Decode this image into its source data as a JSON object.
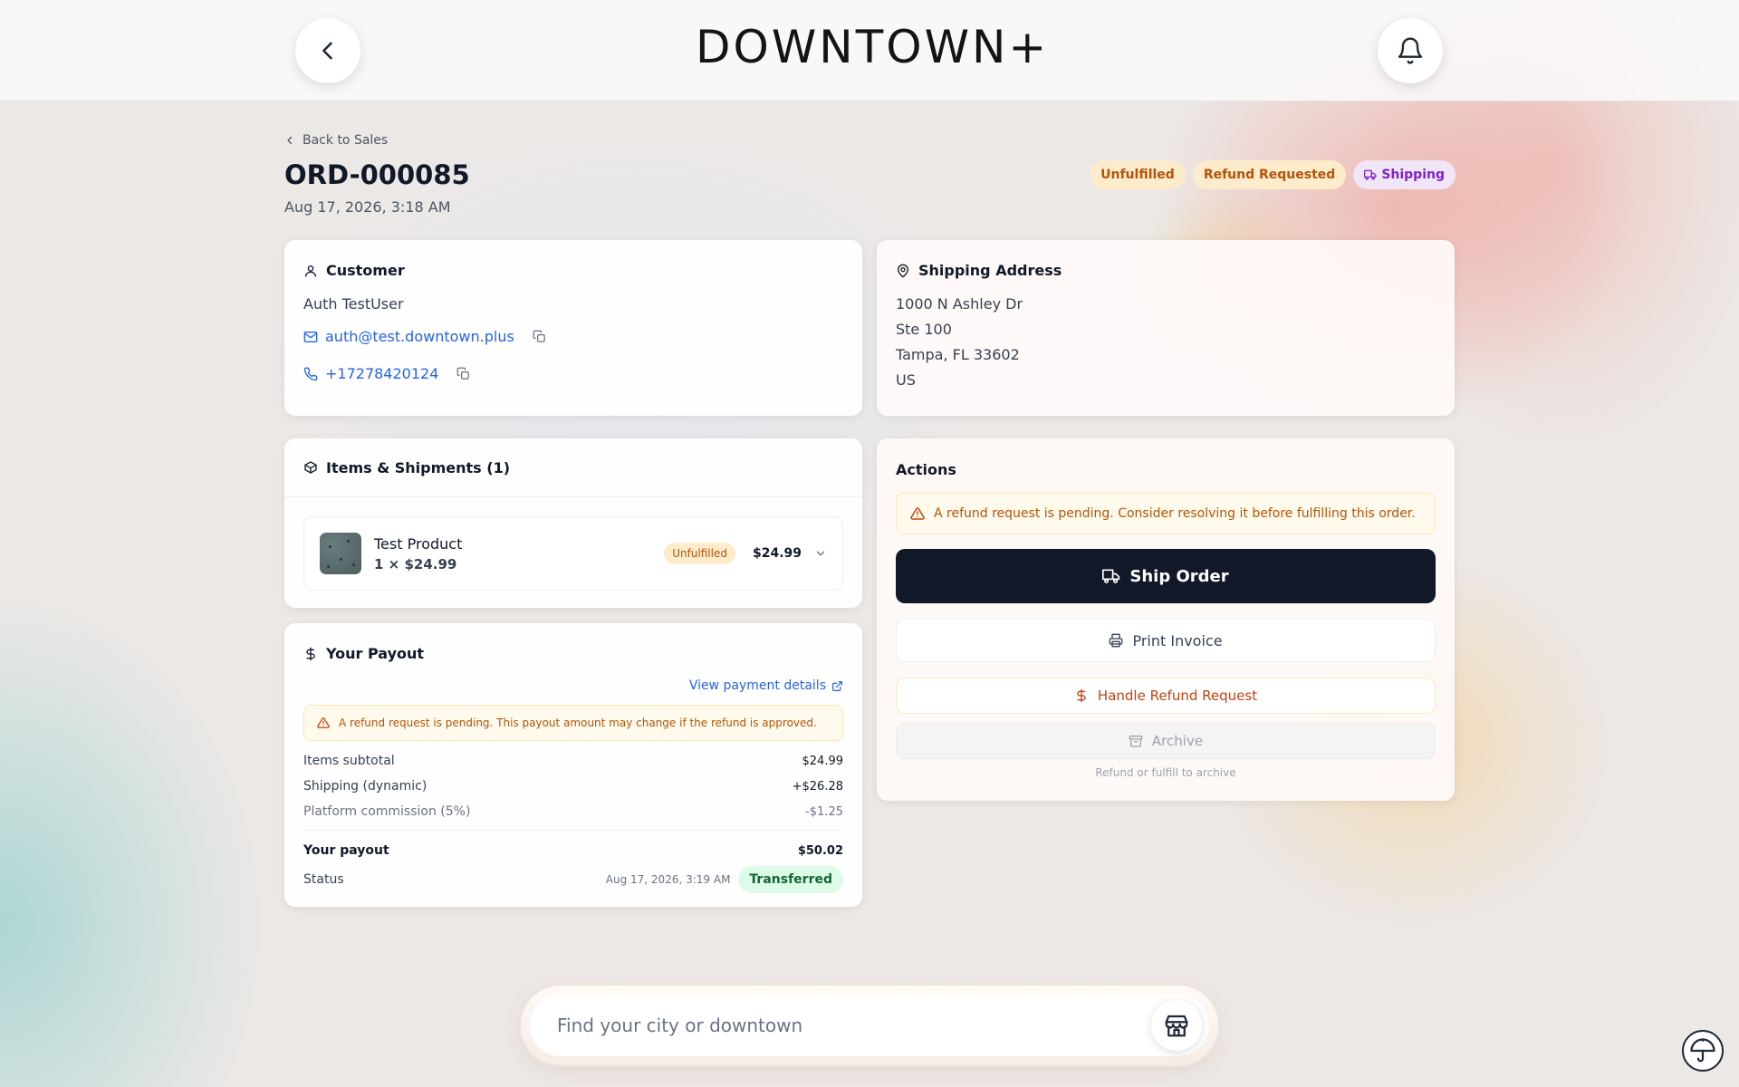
{
  "header": {
    "logo": "DOWNTOWN+",
    "back_button": "chevron-left-icon",
    "notifications_button": "bell-icon"
  },
  "order": {
    "back_link": "Back to Sales",
    "id": "ORD-000085",
    "date": "Aug 17, 2026, 3:18 AM",
    "badges": [
      "Unfulfilled",
      "Refund Requested",
      "Shipping"
    ]
  },
  "customer": {
    "title": "Customer",
    "name": "Auth TestUser",
    "email": "auth@test.downtown.plus",
    "phone": "+17278420124"
  },
  "shipping": {
    "title": "Shipping Address",
    "lines": [
      "1000 N Ashley Dr",
      "Ste 100",
      "Tampa, FL 33602",
      "US"
    ]
  },
  "items": {
    "title": "Items & Shipments (1)",
    "product": {
      "name": "Test Product",
      "qty_price": "1 × $24.99",
      "status": "Unfulfilled",
      "total": "$24.99"
    }
  },
  "payout": {
    "title": "Your Payout",
    "view_link": "View payment details",
    "warning": "A refund request is pending. This payout amount may change if the refund is approved.",
    "rows": [
      {
        "label": "Items subtotal",
        "value": "$24.99"
      },
      {
        "label": "Shipping (dynamic)",
        "value": "+$26.28"
      },
      {
        "label": "Platform commission (5%)",
        "value": "-$1.25"
      }
    ],
    "total_label": "Your payout",
    "total_value": "$50.02",
    "status_label": "Status",
    "status_date": "Aug 17, 2026, 3:19 AM",
    "status_value": "Transferred"
  },
  "actions": {
    "title": "Actions",
    "warning": "A refund request is pending. Consider resolving it before fulfilling this order.",
    "ship": "Ship Order",
    "print": "Print Invoice",
    "refund": "Handle Refund Request",
    "archive": "Archive",
    "archive_note": "Refund or fulfill to archive"
  },
  "search": {
    "placeholder": "Find your city or downtown"
  },
  "colors": {
    "primary_button": "#111827",
    "link": "#2563eb",
    "warning_text": "#b45309",
    "success_bg": "#dcfce7"
  }
}
